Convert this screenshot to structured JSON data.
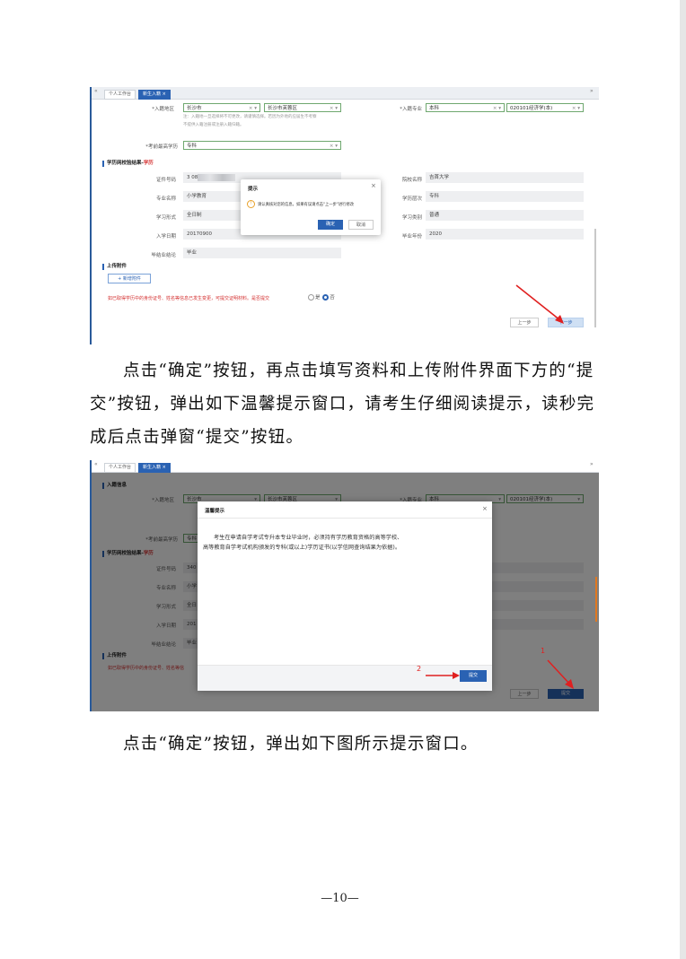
{
  "shot1": {
    "nav_left": "«",
    "nav_right": "»",
    "tabs": [
      "个人工作台",
      "新生入籍"
    ],
    "tab_close": "×",
    "entry_region_label": "*入籍地区",
    "city_value": "长沙市",
    "district_value": "长沙市芙蓉区",
    "region_note_1": "注：入籍地一旦选择将不可更改，请谨慎选择。若因为外地的应届生不考察",
    "region_note_2": "不提供入籍注册或注册入籍归籍。",
    "major_label": "*入籍专业",
    "level_value": "本科",
    "major_value": "020101经济学(本)",
    "min_edu_label": "*考前最高学历",
    "min_edu_value": "专科",
    "section_title": "学历网校验结果-",
    "section_title_red": "学历",
    "rows_left": [
      {
        "label": "证件号码",
        "value": "3          08"
      },
      {
        "label": "专业名称",
        "value": "小学教育"
      },
      {
        "label": "学习形式",
        "value": "全日制"
      },
      {
        "label": "入学日期",
        "value": "20170900"
      },
      {
        "label": "毕结业结论",
        "value": "毕业"
      }
    ],
    "rows_right": [
      {
        "label": "院校名称",
        "value": "吉首大学"
      },
      {
        "label": "学历层次",
        "value": "专科"
      },
      {
        "label": "学习类别",
        "value": "普通"
      },
      {
        "label": "毕业年份",
        "value": "2020"
      }
    ],
    "upload_title": "上传附件",
    "add_attachment": "+ 新增附件",
    "warning": "如已取得学历中的身份证号、姓名等信息已发生变更，可提交证明材料。是否提交",
    "radio_yes": "是",
    "radio_no": "否",
    "prev_button": "上一步",
    "next_button": "下一步",
    "dialog": {
      "title": "提示",
      "close": "×",
      "warn_icon": "!",
      "message": "请认真核对您的信息，如果有误请点击\"上一步\"进行修改",
      "confirm": "确定",
      "cancel": "取消"
    }
  },
  "para1": "点击“确定”按钮，再点击填写资料和上传附件界面下方的“提交”按钮，弹出如下温馨提示窗口，请考生仔细阅读提示，读秒完成后点击弹窗“提交”按钮。",
  "shot2": {
    "nav_left": "«",
    "nav_right": "»",
    "tabs": [
      "个人工作台",
      "新生入籍"
    ],
    "tab_close": "×",
    "info_title": "入籍信息",
    "entry_region_label": "*入籍地区",
    "city_value": "长沙市",
    "district_value": "长沙市芙蓉区",
    "major_label": "*入籍专业",
    "level_value": "本科",
    "major_value": "020101经济学(本)",
    "min_edu_label": "*考前最高学历",
    "min_edu_value": "专科",
    "section_title": "学历网校验结果-",
    "section_title_red": "学历",
    "rows_left": [
      {
        "label": "证件号码",
        "value": "340"
      },
      {
        "label": "专业名称",
        "value": "小学"
      },
      {
        "label": "学习形式",
        "value": "全日"
      },
      {
        "label": "入学日期",
        "value": "201"
      },
      {
        "label": "毕结业结论",
        "value": "毕业"
      }
    ],
    "upload_title": "上传附件",
    "warning": "如已取得学历中的身份证号、姓名等信",
    "prev_button": "上一步",
    "submit_button": "提交",
    "annotation_1": "1",
    "annotation_2": "2",
    "dialog": {
      "title": "温馨提示",
      "close": "×",
      "message_line1": "考生在申请自学考试专升本专业毕业时，必须持有学历教育资格的高等学校、",
      "message_line2": "高等教育自学考试机构颁发的专科(或以上)学历证书(以学信网查询结果为依据)。",
      "submit": "提交"
    }
  },
  "para2": "点击“确定”按钮，弹出如下图所示提示窗口。",
  "page_number": "—10—",
  "colors": {
    "accent": "#2a62b3",
    "red": "#d43030",
    "annotation": "#e02020"
  }
}
